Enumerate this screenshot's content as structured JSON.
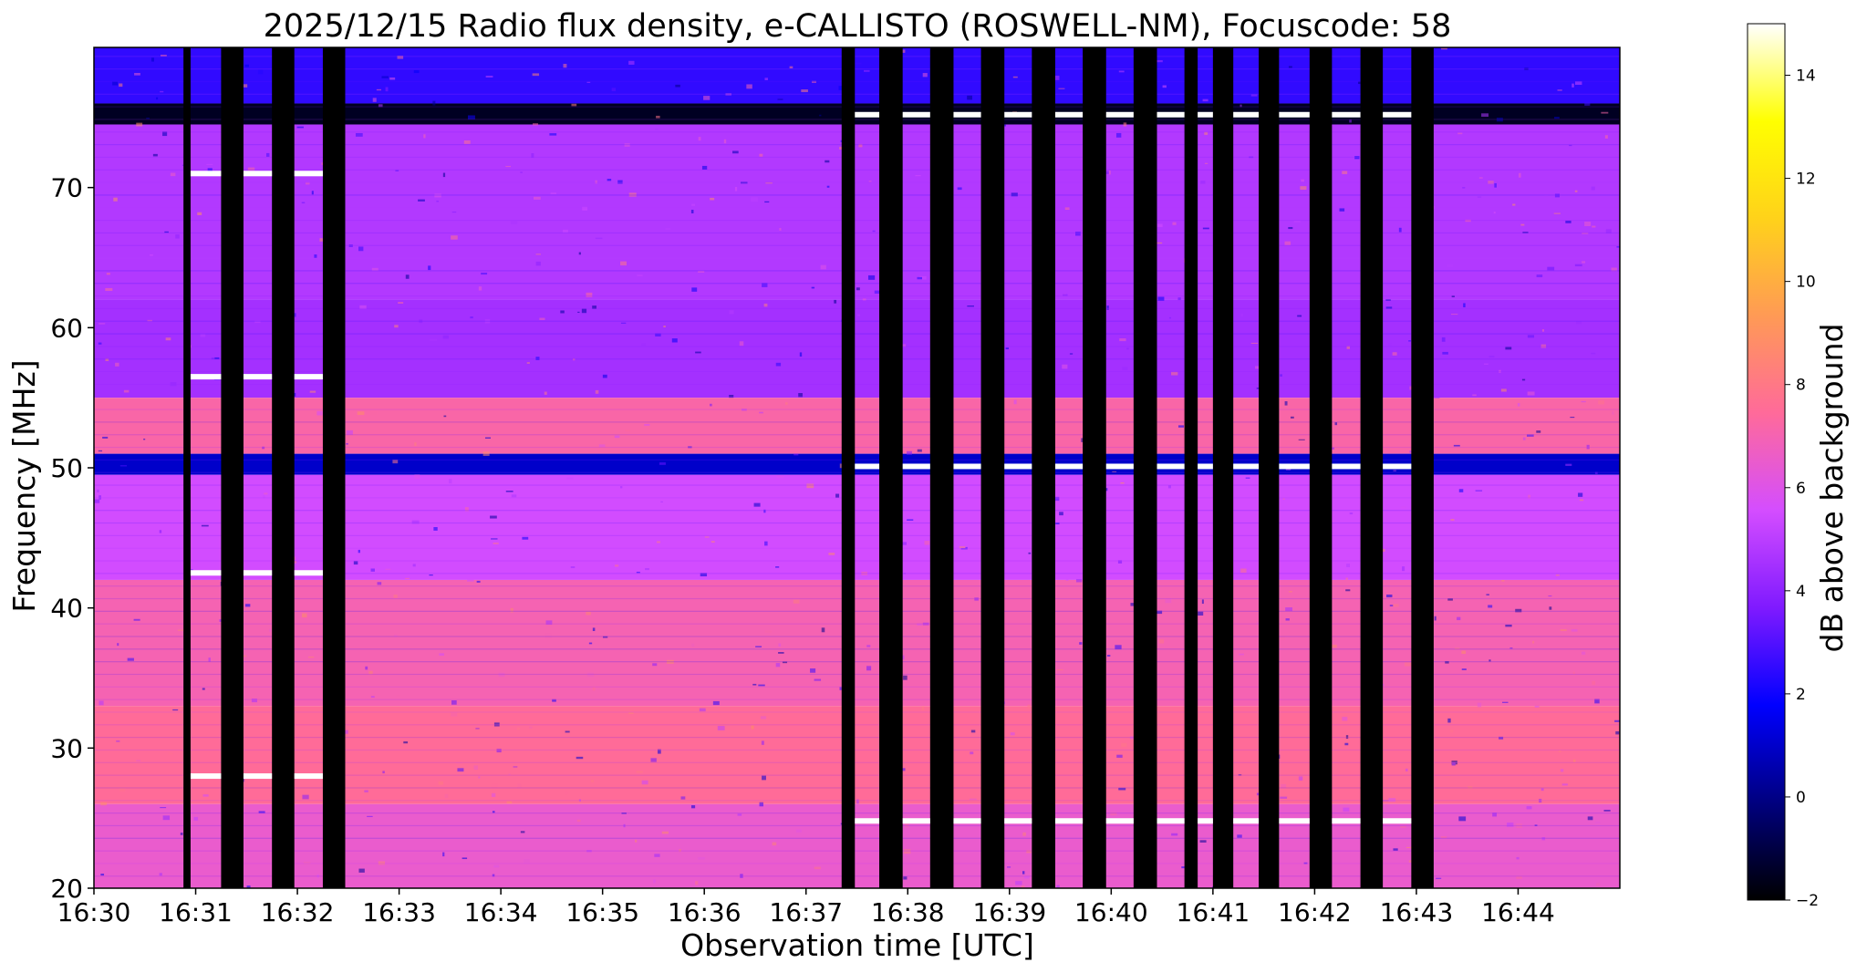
{
  "chart_data": {
    "type": "heatmap",
    "title": "2025/12/15  Radio flux density, e-CALLISTO (ROSWELL-NM), Focuscode: 58",
    "xlabel": "Observation time [UTC]",
    "ylabel": "Frequency [MHz]",
    "x_tick_labels": [
      "16:30",
      "16:31",
      "16:32",
      "16:33",
      "16:34",
      "16:35",
      "16:36",
      "16:37",
      "16:38",
      "16:39",
      "16:40",
      "16:41",
      "16:42",
      "16:43",
      "16:44"
    ],
    "xlim_minutes": [
      0,
      15
    ],
    "y_tick_values": [
      20,
      30,
      40,
      50,
      60,
      70
    ],
    "ylim": [
      20,
      80
    ],
    "colorbar": {
      "label": "dB above background",
      "ticks": [
        -2,
        0,
        2,
        4,
        6,
        8,
        10,
        12,
        14
      ],
      "range": [
        -2,
        15
      ],
      "colormap": "gnuplot2",
      "colors": [
        "#000000",
        "#00007f",
        "#0000ff",
        "#7f1aff",
        "#d44dff",
        "#ff6a9a",
        "#ff9a55",
        "#ffd21a",
        "#ffff00",
        "#ffffff"
      ]
    },
    "background_levels_db": [
      {
        "from": 76,
        "to": 80,
        "value": 2.5
      },
      {
        "from": 74.5,
        "to": 76,
        "value": -1.5
      },
      {
        "from": 62,
        "to": 74.5,
        "value": 4.8
      },
      {
        "from": 55,
        "to": 62,
        "value": 4.5
      },
      {
        "from": 51,
        "to": 55,
        "value": 7.2
      },
      {
        "from": 49.5,
        "to": 51,
        "value": 1.0
      },
      {
        "from": 42,
        "to": 49.5,
        "value": 5.5
      },
      {
        "from": 33,
        "to": 42,
        "value": 7.0
      },
      {
        "from": 26,
        "to": 33,
        "value": 7.5
      },
      {
        "from": 20,
        "to": 26,
        "value": 6.5
      }
    ],
    "dropout_intervals_minutes": [
      [
        0.88,
        0.95
      ],
      [
        1.25,
        1.47
      ],
      [
        1.75,
        1.97
      ],
      [
        2.25,
        2.47
      ],
      [
        7.35,
        7.48
      ],
      [
        7.72,
        7.95
      ],
      [
        8.22,
        8.45
      ],
      [
        8.72,
        8.95
      ],
      [
        9.22,
        9.45
      ],
      [
        9.72,
        9.95
      ],
      [
        10.22,
        10.45
      ],
      [
        10.72,
        10.85
      ],
      [
        11.0,
        11.2
      ],
      [
        11.45,
        11.65
      ],
      [
        11.95,
        12.17
      ],
      [
        12.45,
        12.67
      ],
      [
        12.95,
        13.17
      ]
    ],
    "marker_frequencies_mhz_early": [
      71,
      56.5,
      42.5,
      28
    ],
    "marker_frequencies_mhz_late": [
      75.2,
      50.1,
      24.8
    ]
  }
}
